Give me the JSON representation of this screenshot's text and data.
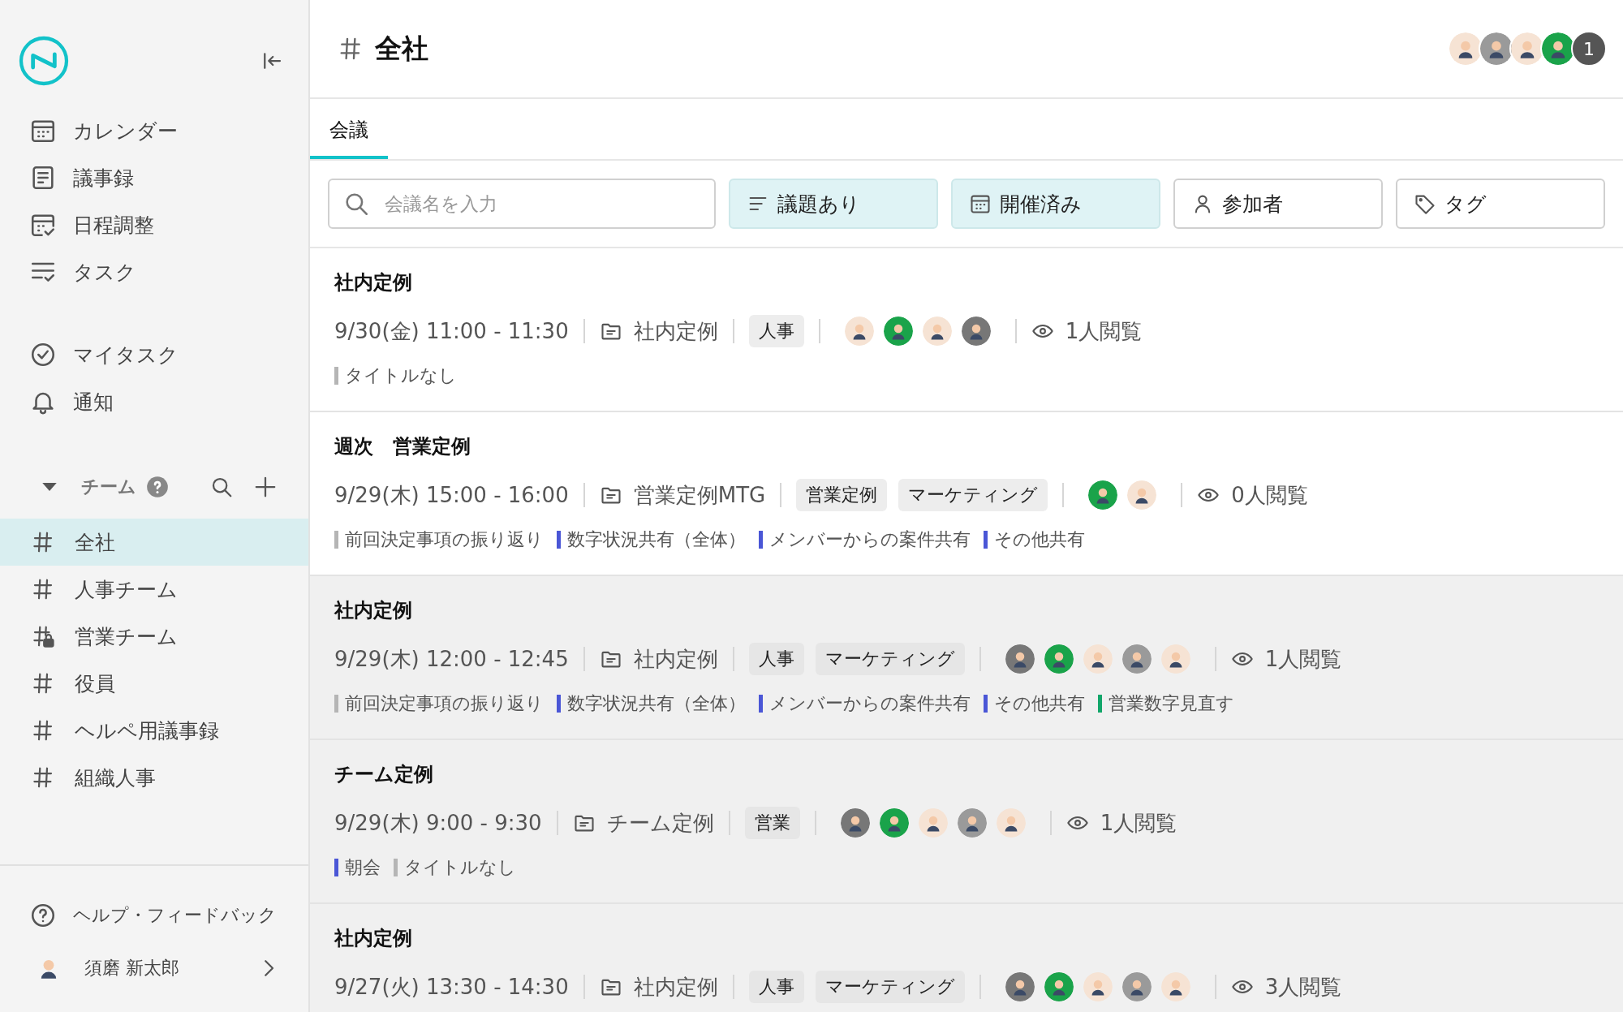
{
  "sidebar": {
    "nav": [
      {
        "label": "カレンダー"
      },
      {
        "label": "議事録"
      },
      {
        "label": "日程調整"
      },
      {
        "label": "タスク"
      }
    ],
    "personal": [
      {
        "label": "マイタスク"
      },
      {
        "label": "通知"
      }
    ],
    "teams_header": {
      "label": "チーム",
      "expanded": true
    },
    "teams": [
      {
        "label": "全社",
        "selected": true,
        "locked": false
      },
      {
        "label": "人事チーム",
        "selected": false,
        "locked": false
      },
      {
        "label": "営業チーム",
        "selected": false,
        "locked": true
      },
      {
        "label": "役員",
        "selected": false,
        "locked": false
      },
      {
        "label": "ヘルペ用議事録",
        "selected": false,
        "locked": false
      },
      {
        "label": "組織人事",
        "selected": false,
        "locked": false
      }
    ],
    "help": "ヘルプ・フィードバック",
    "user": {
      "name": "須磨 新太郎"
    }
  },
  "header": {
    "title": "全社",
    "members": [
      {
        "color": "#f6e3d4"
      },
      {
        "color": "#9a9a9a"
      },
      {
        "color": "#f6e3d4"
      },
      {
        "color": "#1aa34a"
      }
    ],
    "member_count": "1"
  },
  "tabs": [
    {
      "label": "会議",
      "selected": true
    }
  ],
  "filters": {
    "search": {
      "placeholder": "会議名を入力"
    },
    "chips": [
      {
        "label": "議題あり",
        "selected": true
      },
      {
        "label": "開催済み",
        "selected": true
      },
      {
        "label": "参加者",
        "selected": false
      },
      {
        "label": "タグ",
        "selected": false
      }
    ]
  },
  "meetings": [
    {
      "title": "社内定例",
      "shaded": false,
      "date": "9/30(金) 11:00 - 11:30",
      "folder": "社内定例",
      "tags": [
        "人事"
      ],
      "attendees": [
        {
          "color": "#f6e3d4"
        },
        {
          "color": "#1aa34a"
        },
        {
          "color": "#f6e3d4"
        },
        {
          "color": "#777777"
        }
      ],
      "views": "1人閲覧",
      "agenda": [
        {
          "text": "タイトルなし",
          "color": "#b5b5b5"
        }
      ]
    },
    {
      "title": "週次　営業定例",
      "shaded": false,
      "date": "9/29(木) 15:00 - 16:00",
      "folder": "営業定例MTG",
      "tags": [
        "営業定例",
        "マーケティング"
      ],
      "attendees": [
        {
          "color": "#1aa34a"
        },
        {
          "color": "#f6e3d4"
        }
      ],
      "views": "0人閲覧",
      "agenda": [
        {
          "text": "前回決定事項の振り返り",
          "color": "#b5b5b5"
        },
        {
          "text": "数字状況共有（全体）",
          "color": "#4a56d6"
        },
        {
          "text": "メンバーからの案件共有",
          "color": "#4a56d6"
        },
        {
          "text": "その他共有",
          "color": "#4a56d6"
        }
      ]
    },
    {
      "title": "社内定例",
      "shaded": true,
      "date": "9/29(木) 12:00 - 12:45",
      "folder": "社内定例",
      "tags": [
        "人事",
        "マーケティング"
      ],
      "attendees": [
        {
          "color": "#777777"
        },
        {
          "color": "#1aa34a"
        },
        {
          "color": "#f6e3d4"
        },
        {
          "color": "#9a9a9a"
        },
        {
          "color": "#f6e3d4"
        }
      ],
      "views": "1人閲覧",
      "agenda": [
        {
          "text": "前回決定事項の振り返り",
          "color": "#b5b5b5"
        },
        {
          "text": "数字状況共有（全体）",
          "color": "#4a56d6"
        },
        {
          "text": "メンバーからの案件共有",
          "color": "#4a56d6"
        },
        {
          "text": "その他共有",
          "color": "#4a56d6"
        },
        {
          "text": "営業数字見直す",
          "color": "#12a66a"
        }
      ]
    },
    {
      "title": "チーム定例",
      "shaded": true,
      "date": "9/29(木) 9:00 - 9:30",
      "folder": "チーム定例",
      "tags": [
        "営業"
      ],
      "attendees": [
        {
          "color": "#777777"
        },
        {
          "color": "#1aa34a"
        },
        {
          "color": "#f6e3d4"
        },
        {
          "color": "#9a9a9a"
        },
        {
          "color": "#f6e3d4"
        }
      ],
      "views": "1人閲覧",
      "agenda": [
        {
          "text": "朝会",
          "color": "#4a56d6"
        },
        {
          "text": "タイトルなし",
          "color": "#b5b5b5"
        }
      ]
    },
    {
      "title": "社内定例",
      "shaded": true,
      "date": "9/27(火) 13:30 - 14:30",
      "folder": "社内定例",
      "tags": [
        "人事",
        "マーケティング"
      ],
      "attendees": [
        {
          "color": "#777777"
        },
        {
          "color": "#1aa34a"
        },
        {
          "color": "#f6e3d4"
        },
        {
          "color": "#9a9a9a"
        },
        {
          "color": "#f6e3d4"
        }
      ],
      "views": "3人閲覧"
    }
  ]
}
